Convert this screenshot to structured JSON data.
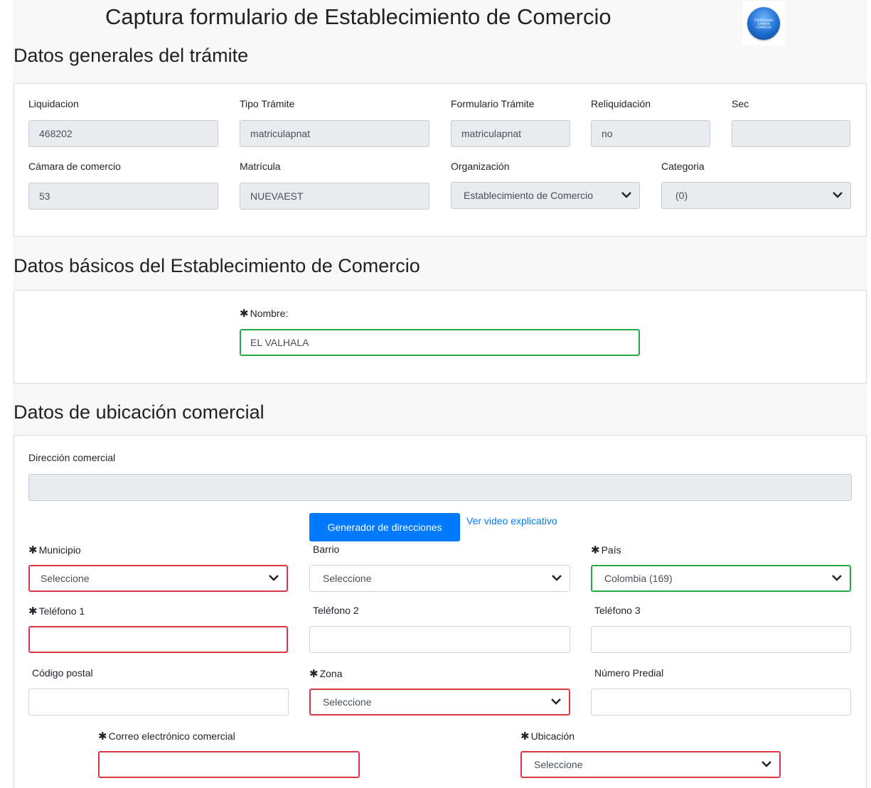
{
  "header": {
    "title": "Captura formulario de Establecimiento de Comercio",
    "logo_text": "FORMULARIO CAMARA COMERCIO"
  },
  "general": {
    "title": "Datos generales del trámite",
    "liquidacion": {
      "label": "Liquidacion",
      "value": "468202"
    },
    "tipo_tramite": {
      "label": "Tipo Trámite",
      "value": "matriculapnat"
    },
    "formulario_tramite": {
      "label": "Formulario Trámite",
      "value": "matriculapnat"
    },
    "reliquidacion": {
      "label": "Reliquidación",
      "value": "no"
    },
    "sec": {
      "label": "Sec",
      "value": ""
    },
    "camara": {
      "label": "Cámara de comercio",
      "value": "53"
    },
    "matricula": {
      "label": "Matrícula",
      "value": "NUEVAEST"
    },
    "organizacion": {
      "label": "Organización",
      "value": "Establecimiento de Comercio"
    },
    "categoria": {
      "label": "Categoria",
      "value": "(0)"
    }
  },
  "basicos": {
    "title": "Datos básicos del Establecimiento de Comercio",
    "nombre": {
      "label": "Nombre:",
      "value": "EL VALHALA"
    }
  },
  "ubicacion": {
    "title": "Datos de ubicación comercial",
    "direccion": {
      "label": "Dirección comercial",
      "value": ""
    },
    "generator_button": "Generador de direcciones",
    "video_link": "Ver video explicativo",
    "municipio": {
      "label": "Municipio",
      "value": "Seleccione"
    },
    "barrio": {
      "label": "Barrio",
      "value": "Seleccione"
    },
    "pais": {
      "label": "País",
      "value": "Colombia (169)"
    },
    "telefono1": {
      "label": "Teléfono 1",
      "value": ""
    },
    "telefono2": {
      "label": "Teléfono 2",
      "value": ""
    },
    "telefono3": {
      "label": "Teléfono 3",
      "value": ""
    },
    "codigo_postal": {
      "label": "Código postal",
      "value": ""
    },
    "zona": {
      "label": "Zona",
      "value": "Seleccione"
    },
    "numero_predial": {
      "label": "Número Predial",
      "value": ""
    },
    "correo": {
      "label": "Correo electrónico comercial",
      "value": ""
    },
    "ubicacion_sel": {
      "label": "Ubicación",
      "value": "Seleccione"
    }
  },
  "required_marker": "✱",
  "colors": {
    "valid": "#28a745",
    "invalid": "#dc3545",
    "primary": "#007bff",
    "readonly": "#e9ecef"
  }
}
